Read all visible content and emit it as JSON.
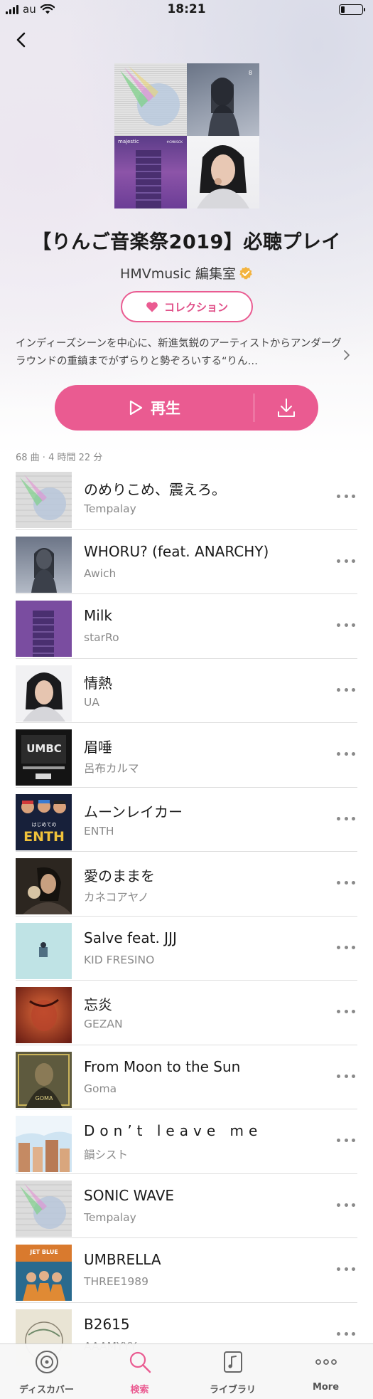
{
  "status_bar": {
    "carrier": "au",
    "time": "18:21",
    "battery_level": 0.2
  },
  "playlist": {
    "title": "【りんご音楽祭2019】必聴プレイ",
    "curator": "HMVmusic 編集室",
    "collection_label": "コレクション",
    "description": "インディーズシーンを中心に、新進気鋭のアーティストからアンダーグラウンドの重鎮までがずらりと勢ぞろいする“りん…",
    "play_label": "再生",
    "meta": "68 曲 · 4 時間 22 分",
    "cover_art_text": {
      "awich_badge": "8",
      "starro_label": "majestic",
      "starro_tag": "#CMKSCK"
    }
  },
  "tracks": [
    {
      "title": "のめりこめ、震えろ。",
      "artist": "Tempalay"
    },
    {
      "title": "WHORU? (feat. ANARCHY)",
      "artist": "Awich"
    },
    {
      "title": "Milk",
      "artist": "starRo"
    },
    {
      "title": "情熱",
      "artist": "UA"
    },
    {
      "title": "眉唾",
      "artist": "呂布カルマ"
    },
    {
      "title": "ムーンレイカー",
      "artist": "ENTH"
    },
    {
      "title": "愛のままを",
      "artist": "カネコアヤノ"
    },
    {
      "title": "Salve feat. JJJ",
      "artist": "KID FRESINO"
    },
    {
      "title": "忘炎",
      "artist": "GEZAN"
    },
    {
      "title": "From Moon to the Sun",
      "artist": "Goma"
    },
    {
      "title": "Don’t leave me",
      "artist": "韻シスト"
    },
    {
      "title": "SONIC WAVE",
      "artist": "Tempalay"
    },
    {
      "title": "UMBRELLA",
      "artist": "THREE1989"
    },
    {
      "title": "B2615",
      "artist": "AAAMYYY"
    }
  ],
  "thumb_text": {
    "umbc": "UMBC",
    "enth_small": "はじめての",
    "enth": "ENTH",
    "goma": "GOMA",
    "three": "JET BLUE"
  },
  "tab_bar": {
    "items": [
      {
        "label": "ディスカバー",
        "icon": "disc-icon"
      },
      {
        "label": "検索",
        "icon": "search-icon",
        "active": true
      },
      {
        "label": "ライブラリ",
        "icon": "music-note-icon"
      },
      {
        "label": "More",
        "icon": "more-icon"
      }
    ]
  },
  "colors": {
    "accent": "#ea5b91",
    "verified": "#f3b33d"
  }
}
